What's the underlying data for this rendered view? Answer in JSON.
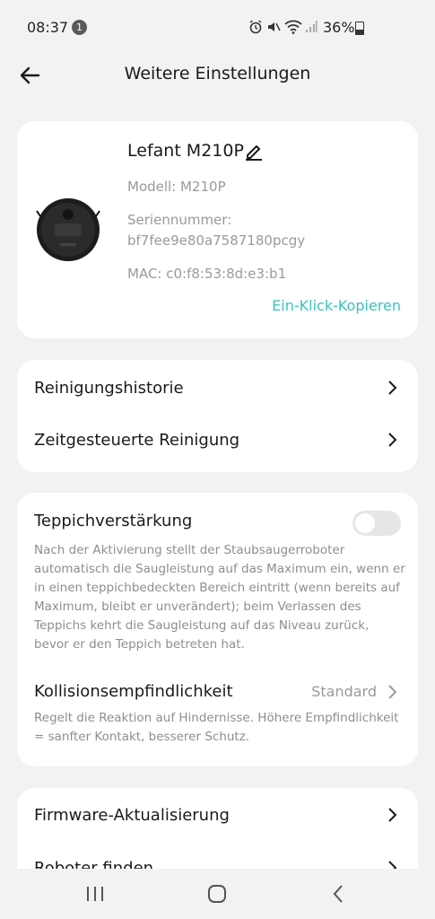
{
  "status": {
    "time": "08:37",
    "notification_count": "1",
    "battery": "36%"
  },
  "header": {
    "title": "Weitere Einstellungen"
  },
  "device": {
    "name": "Lefant M210P",
    "model": "Modell: M210P",
    "serial_label": "Seriennummer:",
    "serial_value": "bf7fee9e80a7587180pcgy",
    "mac": "MAC: c0:f8:53:8d:e3:b1",
    "copy_label": "Ein-Klick-Kopieren"
  },
  "menu1": {
    "history": "Reinigungshistorie",
    "scheduled": "Zeitgesteuerte Reinigung"
  },
  "settings": {
    "carpet_label": "Teppichverstärkung",
    "carpet_enabled": false,
    "carpet_desc": "Nach der Aktivierung stellt der Staubsaugerroboter automatisch die Saugleistung auf das Maximum ein, wenn er in einen teppichbedeckten Bereich eintritt (wenn bereits auf Maximum, bleibt er unverändert); beim Verlassen des Teppichs kehrt die Saugleistung auf das Niveau zurück, bevor er den Teppich betreten hat.",
    "collision_label": "Kollisionsempfindlichkeit",
    "collision_value": "Standard",
    "collision_desc": "Regelt die Reaktion auf Hindernisse. Höhere Empfindlichkeit = sanfter Kontakt, besserer Schutz."
  },
  "menu2": {
    "firmware": "Firmware-Aktualisierung",
    "find_robot": "Roboter finden"
  },
  "colors": {
    "accent": "#3cc3bd",
    "background": "#f2f2f3"
  }
}
